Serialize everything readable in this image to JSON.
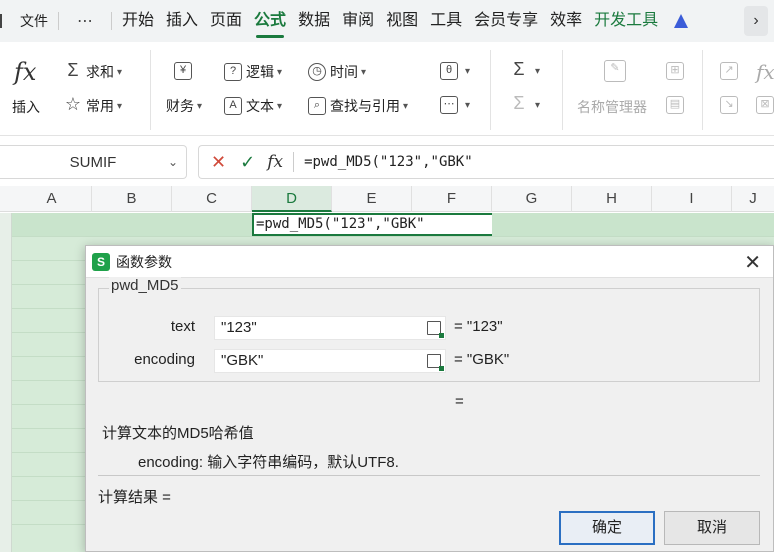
{
  "menu": {
    "file": "文件",
    "more": "⋯",
    "tabs": [
      "开始",
      "插入",
      "页面",
      "公式",
      "数据",
      "审阅",
      "视图",
      "工具",
      "会员专享",
      "效率",
      "开发工具"
    ],
    "active_tab": "公式",
    "scroll_right": "›"
  },
  "ribbon": {
    "insert_function": "插入",
    "autosum": "求和",
    "common": "常用",
    "financial": "财务",
    "logical": "逻辑",
    "text": "文本",
    "datetime": "时间",
    "lookup": "查找与引用",
    "name_manager": "名称管理器"
  },
  "formula_bar": {
    "name_box": "SUMIF",
    "formula": "=pwd_MD5(\"123\",\"GBK\""
  },
  "grid": {
    "columns": [
      "A",
      "B",
      "C",
      "D",
      "E",
      "F",
      "G",
      "H",
      "I",
      "J"
    ],
    "selected_column": "D",
    "cell_edit": "=pwd_MD5(\"123\",\"GBK\""
  },
  "dialog": {
    "title": "函数参数",
    "logo": "S",
    "function_name": "pwd_MD5",
    "args": [
      {
        "label": "text",
        "value": "\"123\"",
        "result": "= \"123\""
      },
      {
        "label": "encoding",
        "value": "\"GBK\"",
        "result": "= \"GBK\""
      }
    ],
    "total_eq": "=",
    "description": "计算文本的MD5哈希值",
    "param_help": "encoding:  输入字符串编码，默认UTF8.",
    "result_label": "计算结果 =",
    "ok": "确定",
    "cancel": "取消"
  }
}
